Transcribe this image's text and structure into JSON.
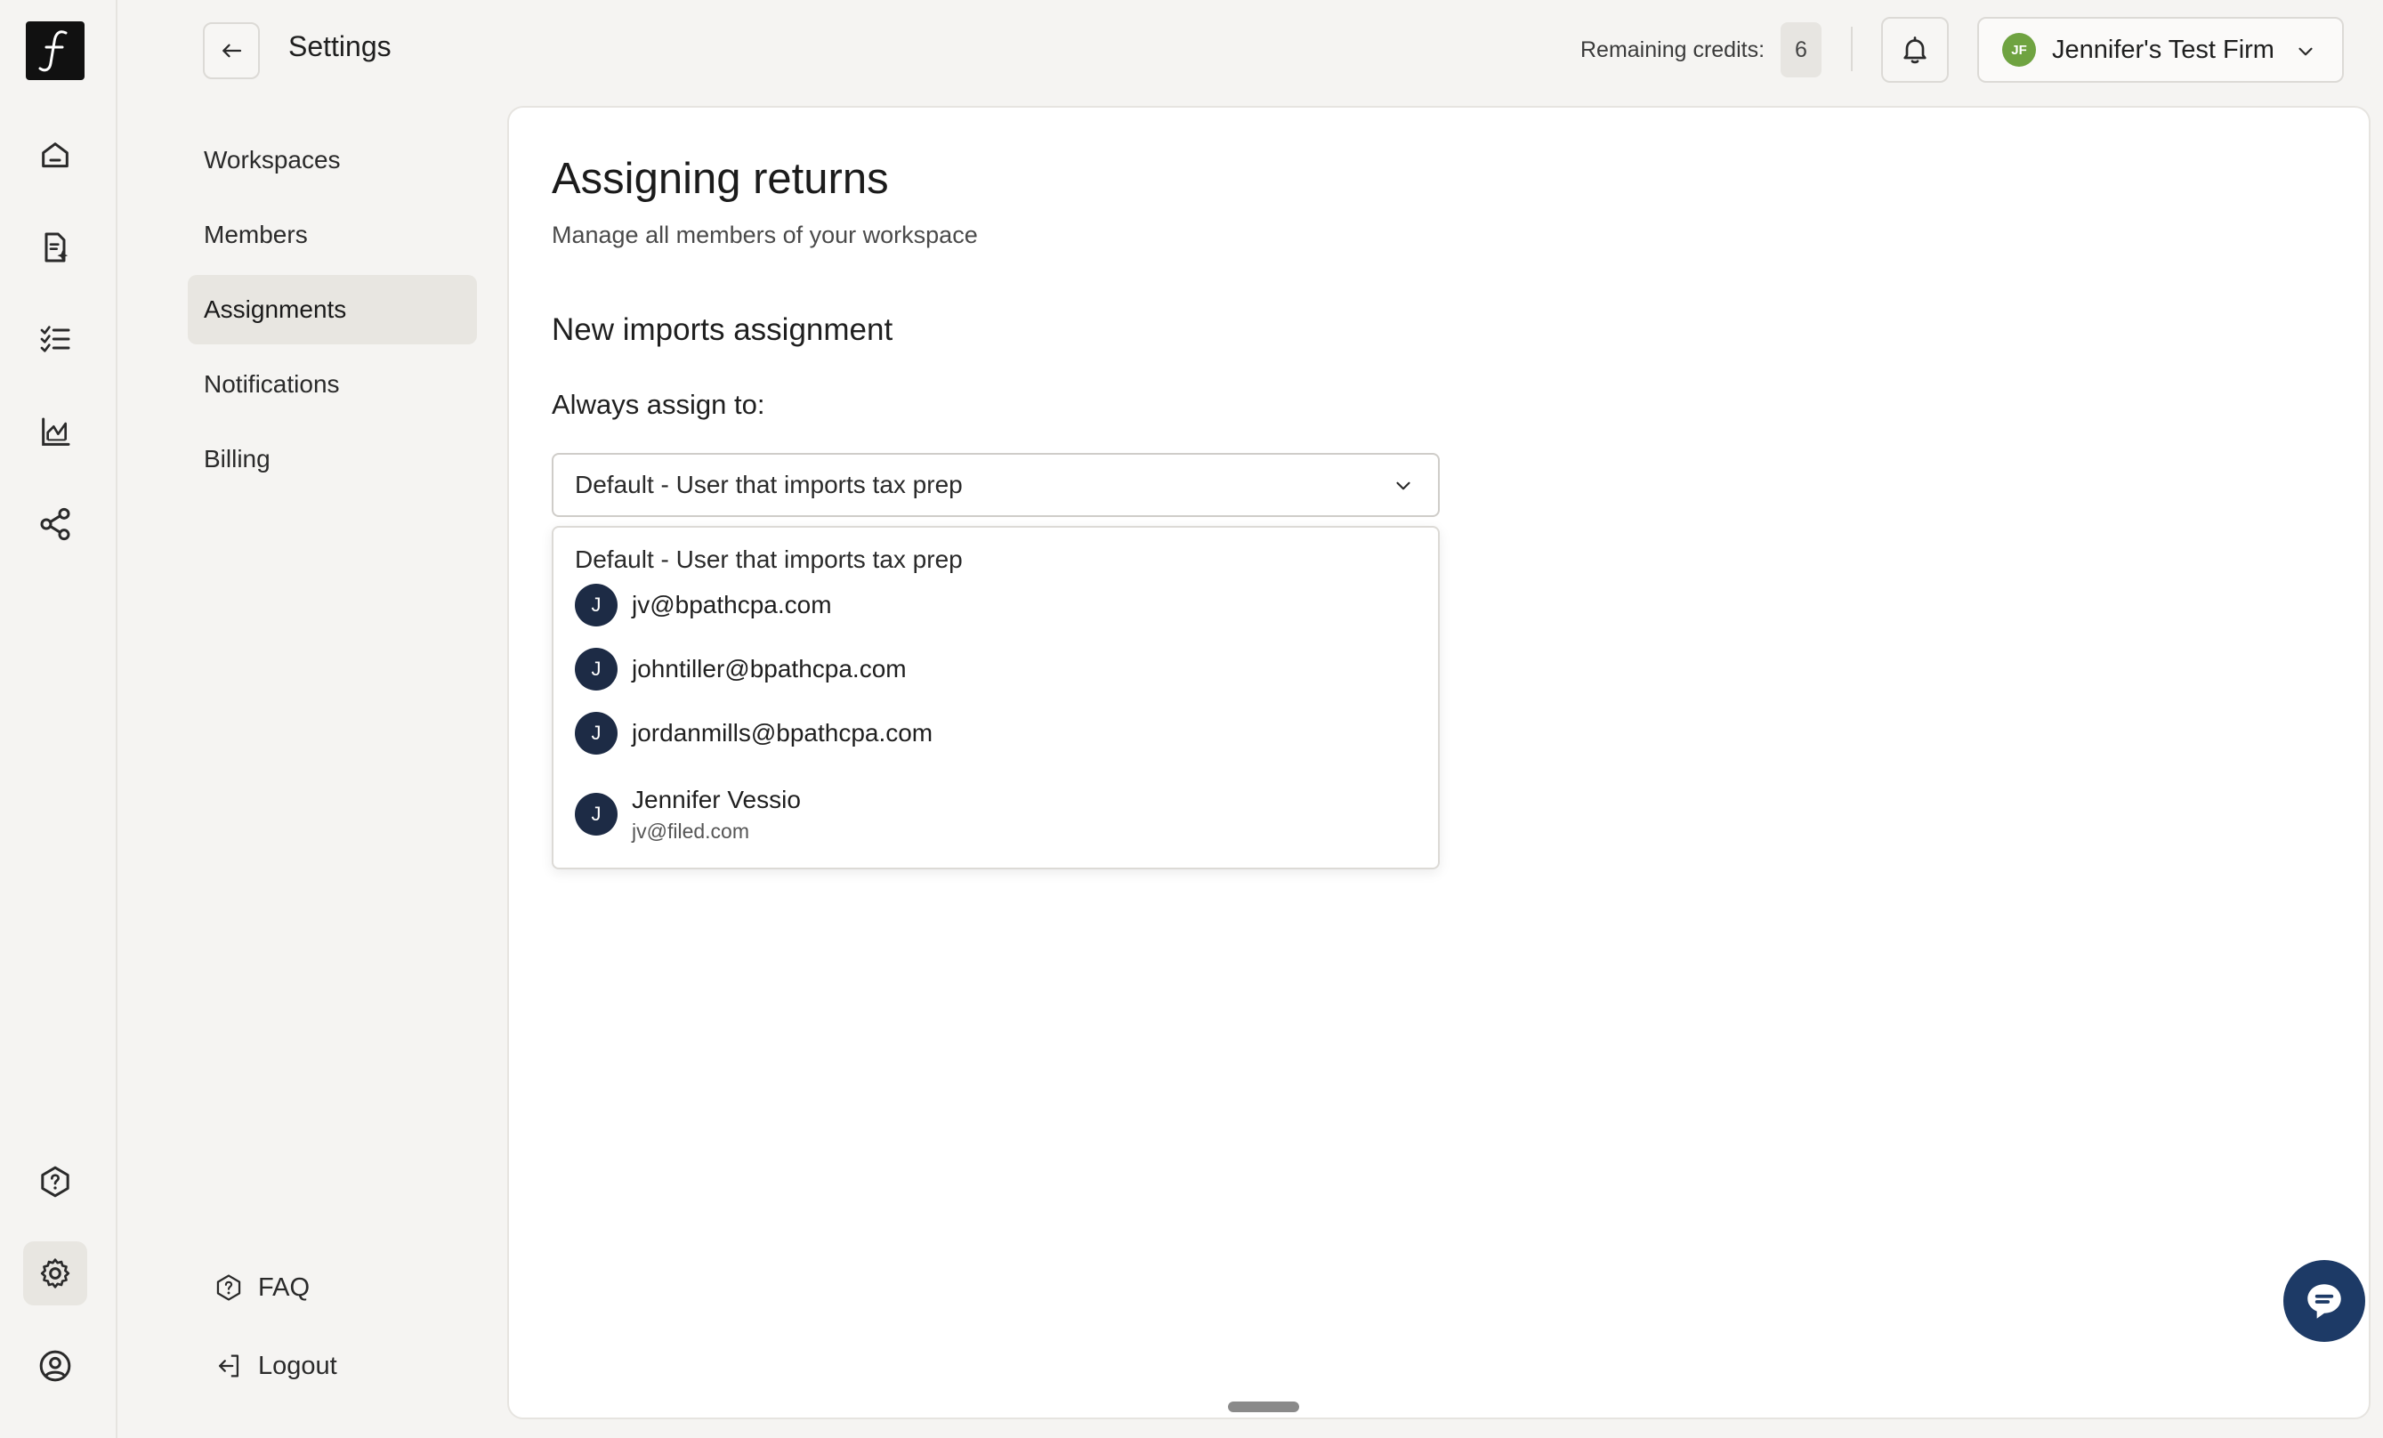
{
  "rail": {
    "logo_glyph": "f",
    "icons": [
      "home-icon",
      "document-sparkle-icon",
      "checklist-icon",
      "chart-icon",
      "share-icon",
      "help-icon",
      "gear-icon",
      "user-circle-icon"
    ]
  },
  "header": {
    "title": "Settings",
    "credits_label": "Remaining credits:",
    "credits_value": "6",
    "firm": {
      "initials": "JF",
      "name": "Jennifer's Test Firm",
      "avatar_color": "#6fa341"
    }
  },
  "settings_nav": {
    "items": [
      {
        "label": "Workspaces",
        "active": false
      },
      {
        "label": "Members",
        "active": false
      },
      {
        "label": "Assignments",
        "active": true
      },
      {
        "label": "Notifications",
        "active": false
      },
      {
        "label": "Billing",
        "active": false
      }
    ],
    "footer": {
      "faq": "FAQ",
      "logout": "Logout"
    }
  },
  "main": {
    "title": "Assigning returns",
    "subtitle": "Manage all members of your workspace",
    "section_title": "New imports assignment",
    "field_label": "Always assign to:",
    "select_value": "Default - User that imports tax prep",
    "options": {
      "default_label": "Default - User that imports tax prep",
      "users": [
        {
          "initial": "J",
          "label": "jv@bpathcpa.com",
          "sub": ""
        },
        {
          "initial": "J",
          "label": "johntiller@bpathcpa.com",
          "sub": ""
        },
        {
          "initial": "J",
          "label": "jordanmills@bpathcpa.com",
          "sub": ""
        },
        {
          "initial": "J",
          "label": "Jennifer Vessio",
          "sub": "jv@filed.com"
        }
      ]
    }
  },
  "colors": {
    "avatar_dark": "#1d2b45",
    "chat_button": "#1d3a66",
    "active_bg": "#e8e6e1"
  }
}
